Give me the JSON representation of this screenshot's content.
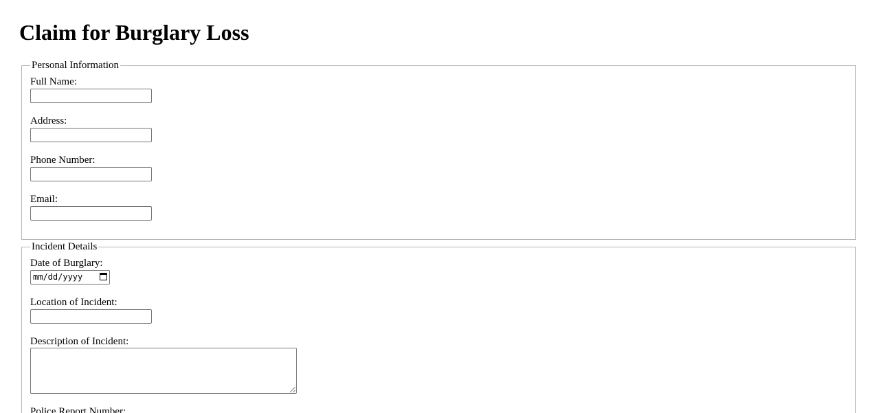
{
  "page": {
    "title": "Claim for Burglary Loss"
  },
  "personal": {
    "legend": "Personal Information",
    "full_name_label": "Full Name:",
    "full_name_value": "",
    "address_label": "Address:",
    "address_value": "",
    "phone_label": "Phone Number:",
    "phone_value": "",
    "email_label": "Email:",
    "email_value": ""
  },
  "incident": {
    "legend": "Incident Details",
    "date_label": "Date of Burglary:",
    "date_placeholder": "mm/dd/yyyy",
    "date_icon": "calendar-icon",
    "location_label": "Location of Incident:",
    "location_value": "",
    "description_label": "Description of Incident:",
    "description_value": "",
    "police_report_label": "Police Report Number:"
  }
}
